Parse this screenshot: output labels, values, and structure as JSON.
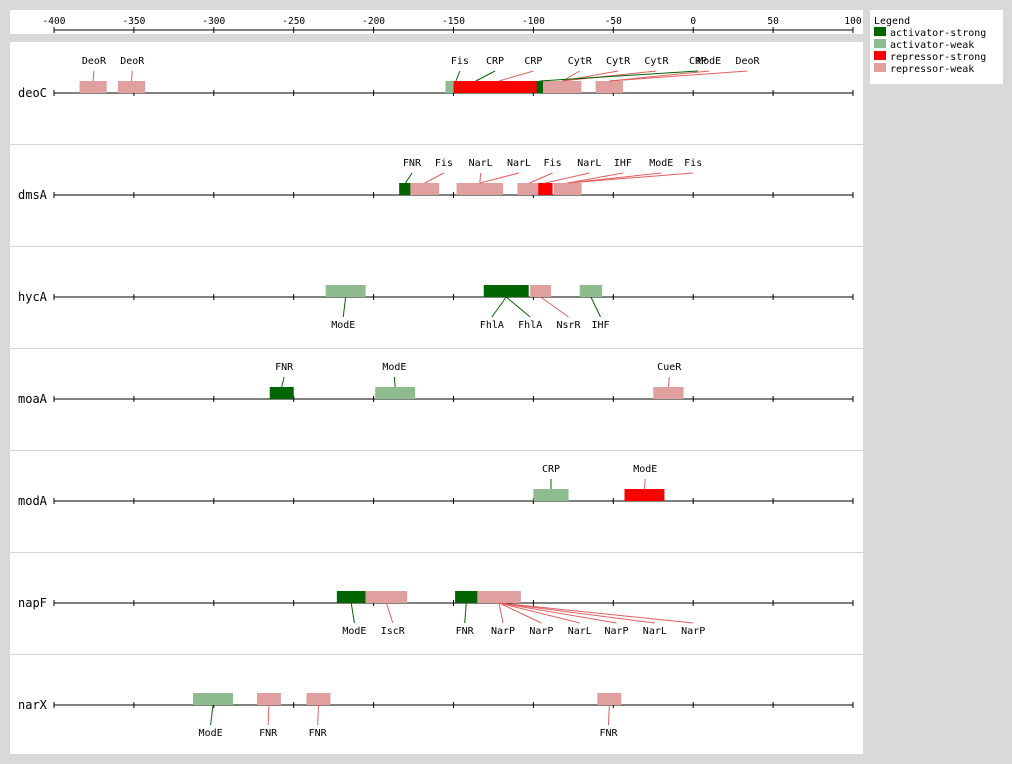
{
  "axis": {
    "range": [
      -400,
      100
    ],
    "ticks": [
      -400,
      -350,
      -300,
      -250,
      -200,
      -150,
      -100,
      -50,
      0,
      50,
      100
    ]
  },
  "legend": {
    "title": "Legend",
    "items": [
      {
        "key": "activator-strong",
        "label": "activator-strong",
        "color": "#006400"
      },
      {
        "key": "activator-weak",
        "label": "activator-weak",
        "color": "#8fbc8f"
      },
      {
        "key": "repressor-strong",
        "label": "repressor-strong",
        "color": "#ff0000"
      },
      {
        "key": "repressor-weak",
        "label": "repressor-weak",
        "color": "#e0a0a0"
      }
    ]
  },
  "genes": [
    {
      "name": "deoC",
      "sites": [
        {
          "tf": "DeoR",
          "start": -384,
          "end": -367,
          "type": "repressor-weak",
          "label_side": "top",
          "label_pos": -375
        },
        {
          "tf": "DeoR",
          "start": -360,
          "end": -343,
          "type": "repressor-weak",
          "label_side": "top",
          "label_pos": -351
        },
        {
          "tf": "Fis",
          "start": -155,
          "end": -142,
          "type": "activator-weak",
          "label_side": "top",
          "label_pos": -146
        },
        {
          "tf": "CRP",
          "start": -150,
          "end": -122,
          "type": "activator-strong",
          "label_side": "top",
          "label_pos": -124
        },
        {
          "tf": "CRP",
          "start": -150,
          "end": -93,
          "type": "repressor-strong",
          "label_side": "top",
          "label_pos": -100
        },
        {
          "tf": "CytR",
          "start": -94,
          "end": -70,
          "type": "repressor-weak",
          "label_side": "top",
          "label_pos": -71
        },
        {
          "tf": "CytR",
          "start": -94,
          "end": -70,
          "type": "repressor-weak",
          "label_side": "top",
          "label_pos": -47
        },
        {
          "tf": "CytR",
          "start": -94,
          "end": -70,
          "type": "repressor-weak",
          "label_side": "top",
          "label_pos": -23
        },
        {
          "tf": "CRP",
          "start": -98,
          "end": -94,
          "type": "activator-strong",
          "label_side": "top",
          "label_pos": 3
        },
        {
          "tf": "ModE",
          "start": -61,
          "end": -44,
          "type": "repressor-weak",
          "label_side": "top",
          "label_pos": 10
        },
        {
          "tf": "DeoR",
          "start": -61,
          "end": -44,
          "type": "repressor-weak",
          "label_side": "top",
          "label_pos": 34
        }
      ]
    },
    {
      "name": "dmsA",
      "sites": [
        {
          "tf": "FNR",
          "start": -184,
          "end": -176,
          "type": "activator-strong",
          "label_side": "top",
          "label_pos": -176
        },
        {
          "tf": "Fis",
          "start": -177,
          "end": -159,
          "type": "repressor-weak",
          "label_side": "top",
          "label_pos": -156
        },
        {
          "tf": "NarL",
          "start": -148,
          "end": -119,
          "type": "repressor-weak",
          "label_side": "top",
          "label_pos": -133
        },
        {
          "tf": "NarL",
          "start": -148,
          "end": -119,
          "type": "repressor-weak",
          "label_side": "top",
          "label_pos": -109
        },
        {
          "tf": "Fis",
          "start": -110,
          "end": -95,
          "type": "repressor-weak",
          "label_side": "top",
          "label_pos": -88
        },
        {
          "tf": "NarL",
          "start": -97,
          "end": -88,
          "type": "repressor-strong",
          "label_side": "top",
          "label_pos": -65
        },
        {
          "tf": "IHF",
          "start": -87,
          "end": -70,
          "type": "repressor-weak",
          "label_side": "top",
          "label_pos": -44
        },
        {
          "tf": "ModE",
          "start": -87,
          "end": -70,
          "type": "repressor-strong",
          "label_side": "top",
          "label_pos": -20
        },
        {
          "tf": "Fis",
          "start": -87,
          "end": -70,
          "type": "repressor-weak",
          "label_side": "top",
          "label_pos": 0
        }
      ]
    },
    {
      "name": "hycA",
      "sites": [
        {
          "tf": "ModE",
          "start": -230,
          "end": -205,
          "type": "activator-weak",
          "label_side": "bottom",
          "label_pos": -219
        },
        {
          "tf": "FhlA",
          "start": -131,
          "end": -103,
          "type": "activator-strong",
          "label_side": "bottom",
          "label_pos": -126
        },
        {
          "tf": "FhlA",
          "start": -131,
          "end": -103,
          "type": "activator-strong",
          "label_side": "bottom",
          "label_pos": -102
        },
        {
          "tf": "NsrR",
          "start": -102,
          "end": -89,
          "type": "repressor-weak",
          "label_side": "bottom",
          "label_pos": -78
        },
        {
          "tf": "IHF",
          "start": -71,
          "end": -57,
          "type": "activator-weak",
          "label_side": "bottom",
          "label_pos": -58
        }
      ]
    },
    {
      "name": "moaA",
      "sites": [
        {
          "tf": "FNR",
          "start": -265,
          "end": -250,
          "type": "activator-strong",
          "label_side": "top",
          "label_pos": -256
        },
        {
          "tf": "ModE",
          "start": -199,
          "end": -174,
          "type": "activator-weak",
          "label_side": "top",
          "label_pos": -187
        },
        {
          "tf": "CueR",
          "start": -25,
          "end": -6,
          "type": "repressor-weak",
          "label_side": "top",
          "label_pos": -15
        }
      ]
    },
    {
      "name": "modA",
      "sites": [
        {
          "tf": "CRP",
          "start": -100,
          "end": -78,
          "type": "activator-weak",
          "label_side": "top",
          "label_pos": -89
        },
        {
          "tf": "ModE",
          "start": -43,
          "end": -18,
          "type": "repressor-strong",
          "label_side": "top",
          "label_pos": -30
        }
      ]
    },
    {
      "name": "napF",
      "sites": [
        {
          "tf": "ModE",
          "start": -223,
          "end": -205,
          "type": "activator-strong",
          "label_side": "bottom",
          "label_pos": -212
        },
        {
          "tf": "IscR",
          "start": -205,
          "end": -179,
          "type": "repressor-weak",
          "label_side": "bottom",
          "label_pos": -188
        },
        {
          "tf": "FNR",
          "start": -149,
          "end": -135,
          "type": "activator-strong",
          "label_side": "bottom",
          "label_pos": -143
        },
        {
          "tf": "NarP",
          "start": -135,
          "end": -108,
          "type": "repressor-weak",
          "label_side": "bottom",
          "label_pos": -119
        },
        {
          "tf": "NarP",
          "start": -135,
          "end": -108,
          "type": "repressor-weak",
          "label_side": "bottom",
          "label_pos": -95
        },
        {
          "tf": "NarL",
          "start": -135,
          "end": -108,
          "type": "repressor-weak",
          "label_side": "bottom",
          "label_pos": -71
        },
        {
          "tf": "NarP",
          "start": -135,
          "end": -108,
          "type": "repressor-weak",
          "label_side": "bottom",
          "label_pos": -48
        },
        {
          "tf": "NarL",
          "start": -135,
          "end": -108,
          "type": "repressor-weak",
          "label_side": "bottom",
          "label_pos": -24
        },
        {
          "tf": "NarP",
          "start": -135,
          "end": -108,
          "type": "repressor-weak",
          "label_side": "bottom",
          "label_pos": 0
        }
      ]
    },
    {
      "name": "narX",
      "sites": [
        {
          "tf": "ModE",
          "start": -313,
          "end": -288,
          "type": "activator-weak",
          "label_side": "bottom",
          "label_pos": -302
        },
        {
          "tf": "FNR",
          "start": -273,
          "end": -258,
          "type": "repressor-weak",
          "label_side": "bottom",
          "label_pos": -266
        },
        {
          "tf": "FNR",
          "start": -242,
          "end": -227,
          "type": "repressor-weak",
          "label_side": "bottom",
          "label_pos": -235
        },
        {
          "tf": "FNR",
          "start": -60,
          "end": -45,
          "type": "repressor-weak",
          "label_side": "bottom",
          "label_pos": -53
        }
      ]
    }
  ]
}
